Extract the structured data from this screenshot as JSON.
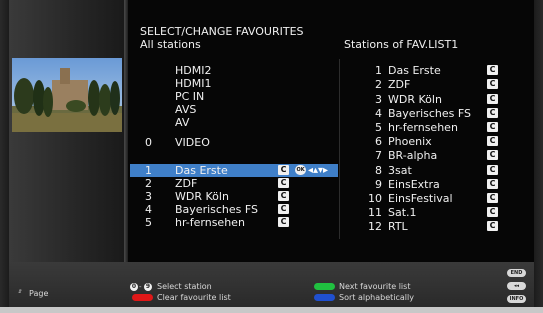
{
  "header": {
    "title": "SELECT/CHANGE FAVOURITES",
    "left_subtitle": "All stations",
    "right_subtitle": "Stations of FAV.LIST1"
  },
  "sources": [
    "HDMI2",
    "HDMI1",
    "PC IN",
    "AVS",
    "AV"
  ],
  "video": {
    "num": "0",
    "name": "VIDEO"
  },
  "stations": [
    {
      "num": "1",
      "name": "Das Erste",
      "badge": "C",
      "selected": true
    },
    {
      "num": "2",
      "name": "ZDF",
      "badge": "C"
    },
    {
      "num": "3",
      "name": "WDR Köln",
      "badge": "C"
    },
    {
      "num": "4",
      "name": "Bayerisches FS",
      "badge": "C"
    },
    {
      "num": "5",
      "name": "hr-fernsehen",
      "badge": "C"
    }
  ],
  "selected_actions": {
    "ok": "OK",
    "arrows": "◂▴▾▸"
  },
  "favourites": [
    {
      "num": "1",
      "name": "Das Erste",
      "badge": "C"
    },
    {
      "num": "2",
      "name": "ZDF",
      "badge": "C"
    },
    {
      "num": "3",
      "name": "WDR Köln",
      "badge": "C"
    },
    {
      "num": "4",
      "name": "Bayerisches FS",
      "badge": "C"
    },
    {
      "num": "5",
      "name": "hr-fernsehen",
      "badge": "C"
    },
    {
      "num": "6",
      "name": "Phoenix",
      "badge": "C"
    },
    {
      "num": "7",
      "name": "BR-alpha",
      "badge": "C"
    },
    {
      "num": "8",
      "name": "3sat",
      "badge": "C"
    },
    {
      "num": "9",
      "name": "EinsExtra",
      "badge": "C"
    },
    {
      "num": "10",
      "name": "EinsFestival",
      "badge": "C"
    },
    {
      "num": "11",
      "name": "Sat.1",
      "badge": "C"
    },
    {
      "num": "12",
      "name": "RTL",
      "badge": "C"
    }
  ],
  "footer": {
    "page_label": "Page",
    "page_icon": "⇵",
    "key_0": "0",
    "key_9": "9",
    "key_sep": "-",
    "select_station": "Select station",
    "clear_list": "Clear favourite list",
    "next_list": "Next favourite list",
    "sort_alpha": "Sort alphabetically",
    "end_key": "END",
    "back_key": "◂◂",
    "info_key": "INFO"
  },
  "colors": {
    "selection": "#3f7fc8",
    "red": "#e01818",
    "green": "#20c040",
    "blue": "#2050d0"
  }
}
